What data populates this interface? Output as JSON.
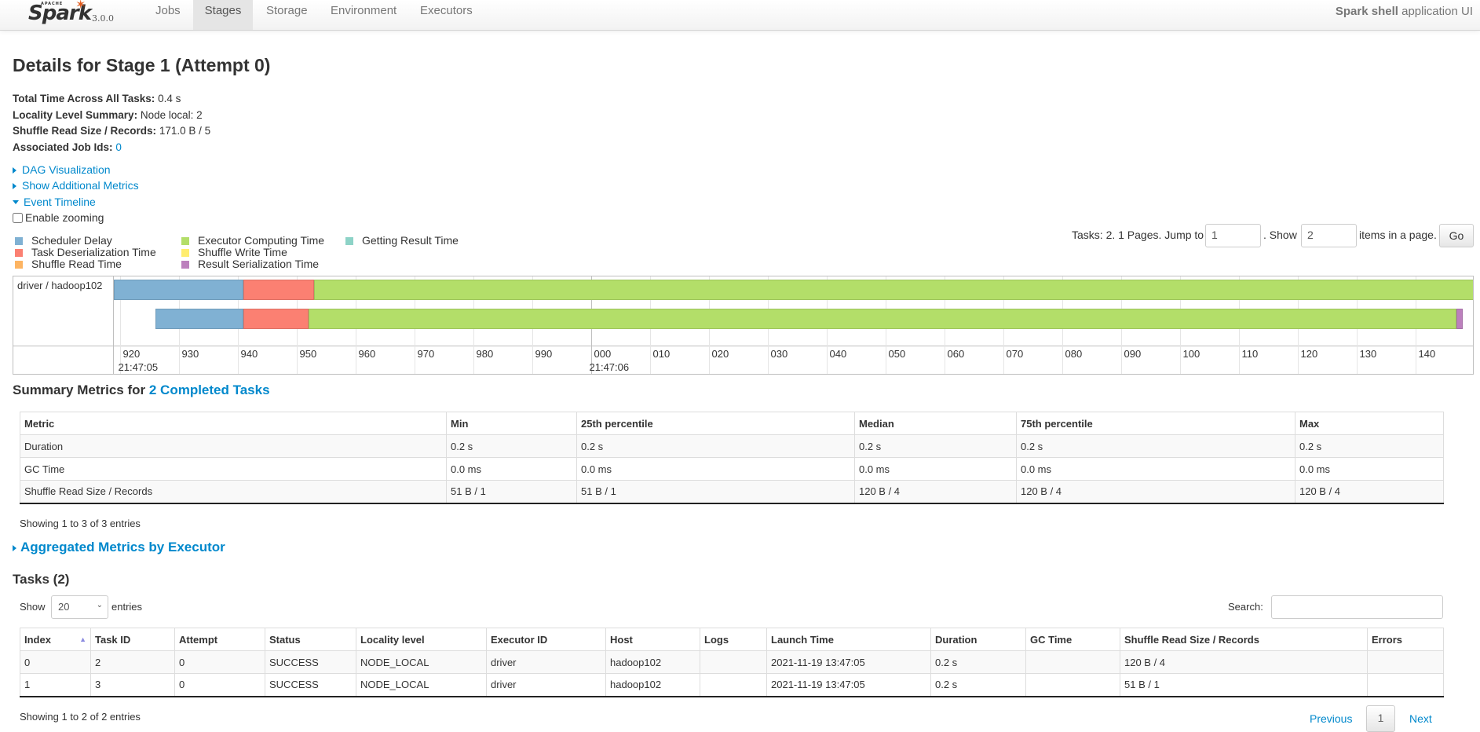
{
  "nav": {
    "logo": {
      "apache": "APACHE",
      "word": "Spark",
      "version": "3.0.0"
    },
    "tabs": [
      {
        "label": "Jobs"
      },
      {
        "label": "Stages",
        "active": true
      },
      {
        "label": "Storage"
      },
      {
        "label": "Environment"
      },
      {
        "label": "Executors"
      }
    ],
    "app_name": "Spark shell",
    "app_suffix": "application UI"
  },
  "page": {
    "title": "Details for Stage 1 (Attempt 0)",
    "info": [
      {
        "label": "Total Time Across All Tasks:",
        "value": "0.4 s"
      },
      {
        "label": "Locality Level Summary:",
        "value": "Node local: 2"
      },
      {
        "label": "Shuffle Read Size / Records:",
        "value": "171.0 B / 5"
      },
      {
        "label": "Associated Job Ids:",
        "value": "0"
      }
    ],
    "toggles": {
      "dag": "DAG Visualization",
      "additional": "Show Additional Metrics",
      "timeline": "Event Timeline"
    },
    "enable_zooming": "Enable zooming"
  },
  "legend": [
    {
      "label": "Scheduler Delay",
      "color": "#80B1D3"
    },
    {
      "label": "Task Deserialization Time",
      "color": "#FB8072"
    },
    {
      "label": "Shuffle Read Time",
      "color": "#FDB462"
    },
    {
      "label": "Executor Computing Time",
      "color": "#B3DE69"
    },
    {
      "label": "Shuffle Write Time",
      "color": "#FFED6F"
    },
    {
      "label": "Result Serialization Time",
      "color": "#BC80BD"
    },
    {
      "label": "Getting Result Time",
      "color": "#8DD3C7"
    }
  ],
  "paging": {
    "prefix": "Tasks: 2. 1 Pages. Jump to",
    "page": "1",
    "show": ". Show",
    "size": "2",
    "suffix": "items in a page.",
    "go": "Go"
  },
  "timeline": {
    "group": "driver / hadoop102",
    "axis_ms": [
      919,
      1150
    ],
    "ticks": [
      "920",
      "930",
      "940",
      "950",
      "960",
      "970",
      "980",
      "990",
      "000",
      "010",
      "020",
      "030",
      "040",
      "050",
      "060",
      "070",
      "080",
      "090",
      "100",
      "110",
      "120",
      "130",
      "140"
    ],
    "second_labels": [
      {
        "label": "21:47:05",
        "at_ms": 920
      },
      {
        "label": "21:47:06",
        "at_ms": 1000
      }
    ],
    "tasks": [
      {
        "segments": [
          {
            "legend": 0,
            "start": 919,
            "end": 941
          },
          {
            "legend": 1,
            "start": 941,
            "end": 953
          },
          {
            "legend": 3,
            "start": 953,
            "end": 1150
          }
        ]
      },
      {
        "segments": [
          {
            "legend": 0,
            "start": 926,
            "end": 941
          },
          {
            "legend": 1,
            "start": 941,
            "end": 952
          },
          {
            "legend": 3,
            "start": 952,
            "end": 1147
          },
          {
            "legend": 5,
            "start": 1147,
            "end": 1148
          }
        ]
      }
    ]
  },
  "summary": {
    "title_prefix": "Summary Metrics for",
    "title_link": "2 Completed Tasks",
    "headers": [
      "Metric",
      "Min",
      "25th percentile",
      "Median",
      "75th percentile",
      "Max"
    ],
    "rows": [
      [
        "Duration",
        "0.2 s",
        "0.2 s",
        "0.2 s",
        "0.2 s",
        "0.2 s"
      ],
      [
        "GC Time",
        "0.0 ms",
        "0.0 ms",
        "0.0 ms",
        "0.0 ms",
        "0.0 ms"
      ],
      [
        "Shuffle Read Size / Records",
        "51 B / 1",
        "51 B / 1",
        "120 B / 4",
        "120 B / 4",
        "120 B / 4"
      ]
    ],
    "showing": "Showing 1 to 3 of 3 entries"
  },
  "aggregated": "Aggregated Metrics by Executor",
  "tasks": {
    "title": "Tasks (2)",
    "show": "Show",
    "entries_value": "20",
    "entries": "entries",
    "search_label": "Search:",
    "search_value": "",
    "headers": [
      "Index",
      "Task ID",
      "Attempt",
      "Status",
      "Locality level",
      "Executor ID",
      "Host",
      "Logs",
      "Launch Time",
      "Duration",
      "GC Time",
      "Shuffle Read Size / Records",
      "Errors"
    ],
    "rows": [
      [
        "0",
        "2",
        "0",
        "SUCCESS",
        "NODE_LOCAL",
        "driver",
        "hadoop102",
        "",
        "2021-11-19 13:47:05",
        "0.2 s",
        "",
        "120 B / 4",
        ""
      ],
      [
        "1",
        "3",
        "0",
        "SUCCESS",
        "NODE_LOCAL",
        "driver",
        "hadoop102",
        "",
        "2021-11-19 13:47:05",
        "0.2 s",
        "",
        "51 B / 1",
        ""
      ]
    ],
    "showing": "Showing 1 to 2 of 2 entries",
    "previous": "Previous",
    "current_page": "1",
    "next": "Next"
  }
}
